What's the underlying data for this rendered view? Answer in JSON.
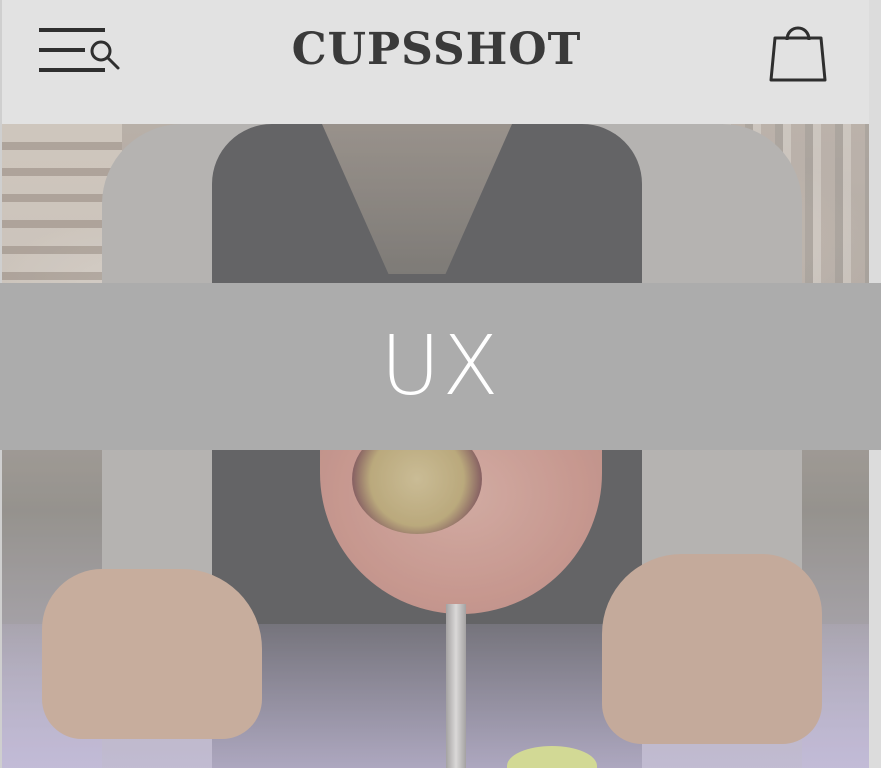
{
  "header": {
    "brand": "CUPSSHOT",
    "menu_icon": "menu-search-icon",
    "cart_icon": "shopping-bag-icon"
  },
  "hero": {
    "image_alt": "bartender-cocktail-photo"
  },
  "overlay": {
    "label": "UX"
  },
  "colors": {
    "header_bg": "#e2e2e2",
    "band_bg": "#acacac",
    "brand_text": "#3a3a3a",
    "overlay_text": "#ffffff"
  }
}
